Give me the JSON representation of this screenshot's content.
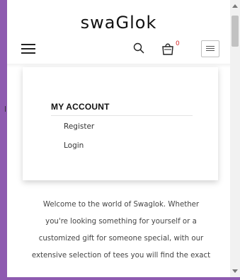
{
  "header": {
    "logo_text": "swaGlok",
    "cart_count": "0"
  },
  "account_menu": {
    "title": "MY ACCOUNT",
    "items": [
      {
        "label": "Register"
      },
      {
        "label": "Login"
      }
    ]
  },
  "welcome": {
    "lines": [
      "Welcome to the world of Swaglok. Whether",
      "you're looking something for yourself or a",
      "customized gift for someone special, with our",
      "extensive selection of tees you will find the exact"
    ]
  },
  "icons": {
    "menu": "hamburger-icon",
    "search": "search-icon",
    "cart": "shopping-bag-icon",
    "toggle": "menu-toggle-icon"
  },
  "colors": {
    "frame_accent": "#8e5bb0",
    "cart_count": "#d62a2a"
  }
}
